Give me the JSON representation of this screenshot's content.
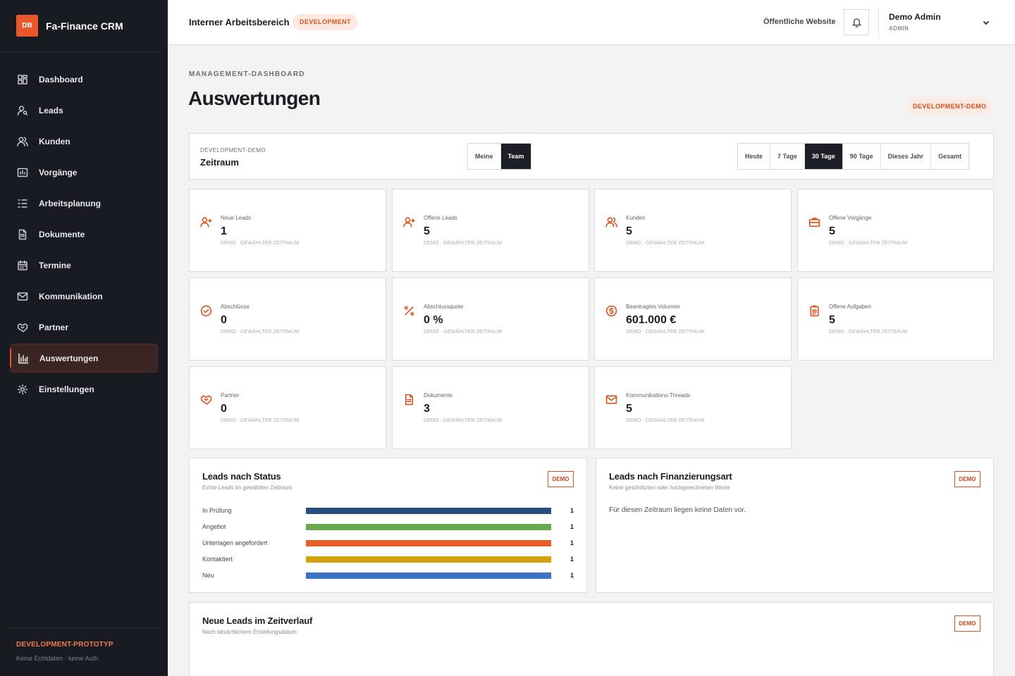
{
  "brand": {
    "logo": "DB",
    "name": "Fa-Finance CRM"
  },
  "sidebar": {
    "items": [
      {
        "label": "Dashboard",
        "icon": "dashboard-icon"
      },
      {
        "label": "Leads",
        "icon": "user-search-icon"
      },
      {
        "label": "Kunden",
        "icon": "users-icon"
      },
      {
        "label": "Vorgänge",
        "icon": "chart-box-icon"
      },
      {
        "label": "Arbeitsplanung",
        "icon": "list-check-icon"
      },
      {
        "label": "Dokumente",
        "icon": "document-icon"
      },
      {
        "label": "Termine",
        "icon": "calendar-icon"
      },
      {
        "label": "Kommunikation",
        "icon": "mail-icon"
      },
      {
        "label": "Partner",
        "icon": "handshake-icon"
      },
      {
        "label": "Auswertungen",
        "icon": "bar-chart-icon",
        "active": true
      },
      {
        "label": "Einstellungen",
        "icon": "gear-icon"
      }
    ],
    "footer_title": "DEVELOPMENT-PROTOTYP",
    "footer_sub": "Keine Echtdaten · keine Auth"
  },
  "topbar": {
    "workspace": "Interner Arbeitsbereich",
    "badge": "DEVELOPMENT",
    "public_link": "Öffentliche Website",
    "user_name": "Demo Admin",
    "user_role": "ADMIN"
  },
  "page": {
    "eyebrow": "MANAGEMENT-DASHBOARD",
    "title": "Auswertungen",
    "badge": "DEVELOPMENT-DEMO"
  },
  "period": {
    "eyebrow": "DEVELOPMENT-DEMO",
    "title": "Zeitraum",
    "scope": [
      "Meine",
      "Team"
    ],
    "scope_selected": "Team",
    "ranges": [
      "Heute",
      "7 Tage",
      "30 Tage",
      "90 Tage",
      "Dieses Jahr",
      "Gesamt"
    ],
    "range_selected": "30 Tage"
  },
  "kpis": [
    {
      "label": "Neue Leads",
      "value": "1",
      "sub": "DEMO · GEWÄHLTER ZEITRAUM",
      "icon": "user-plus-icon"
    },
    {
      "label": "Offene Leads",
      "value": "5",
      "sub": "DEMO · GEWÄHLTER ZEITRAUM",
      "icon": "user-plus-icon"
    },
    {
      "label": "Kunden",
      "value": "5",
      "sub": "DEMO · GEWÄHLTER ZEITRAUM",
      "icon": "users-icon"
    },
    {
      "label": "Offene Vorgänge",
      "value": "5",
      "sub": "DEMO · GEWÄHLTER ZEITRAUM",
      "icon": "briefcase-icon"
    },
    {
      "label": "Abschlüsse",
      "value": "0",
      "sub": "DEMO · GEWÄHLTER ZEITRAUM",
      "icon": "check-circle-icon"
    },
    {
      "label": "Abschlussquote",
      "value": "0 %",
      "sub": "DEMO · GEWÄHLTER ZEITRAUM",
      "icon": "percent-icon"
    },
    {
      "label": "Beantragtes Volumen",
      "value": "601.000 €",
      "sub": "DEMO · GEWÄHLTER ZEITRAUM",
      "icon": "dollar-circle-icon"
    },
    {
      "label": "Offene Aufgaben",
      "value": "5",
      "sub": "DEMO · GEWÄHLTER ZEITRAUM",
      "icon": "clipboard-icon"
    },
    {
      "label": "Partner",
      "value": "0",
      "sub": "DEMO · GEWÄHLTER ZEITRAUM",
      "icon": "handshake-icon"
    },
    {
      "label": "Dokumente",
      "value": "3",
      "sub": "DEMO · GEWÄHLTER ZEITRAUM",
      "icon": "document-icon"
    },
    {
      "label": "Kommunikations-Threads",
      "value": "5",
      "sub": "DEMO · GEWÄHLTER ZEITRAUM",
      "icon": "mail-icon"
    }
  ],
  "leads_status": {
    "title": "Leads nach Status",
    "subtitle": "Echte Leads im gewählten Zeitraum",
    "tag": "DEMO",
    "rows": [
      {
        "label": "In Prüfung",
        "value": "1",
        "color": "#2a4e82"
      },
      {
        "label": "Angebot",
        "value": "1",
        "color": "#6aa84f"
      },
      {
        "label": "Unterlagen angefordert",
        "value": "1",
        "color": "#e85d2a"
      },
      {
        "label": "Kontaktiert",
        "value": "1",
        "color": "#d4a20c"
      },
      {
        "label": "Neu",
        "value": "1",
        "color": "#3a72c4"
      }
    ]
  },
  "leads_finance": {
    "title": "Leads nach Finanzierungsart",
    "subtitle": "Keine geschätzten oder hochgerechneten Werte",
    "tag": "DEMO",
    "empty": "Für diesen Zeitraum liegen keine Daten vor."
  },
  "leads_timeline": {
    "title": "Neue Leads im Zeitverlauf",
    "subtitle": "Nach tatsächlichem Erstellungsdatum",
    "tag": "DEMO"
  }
}
